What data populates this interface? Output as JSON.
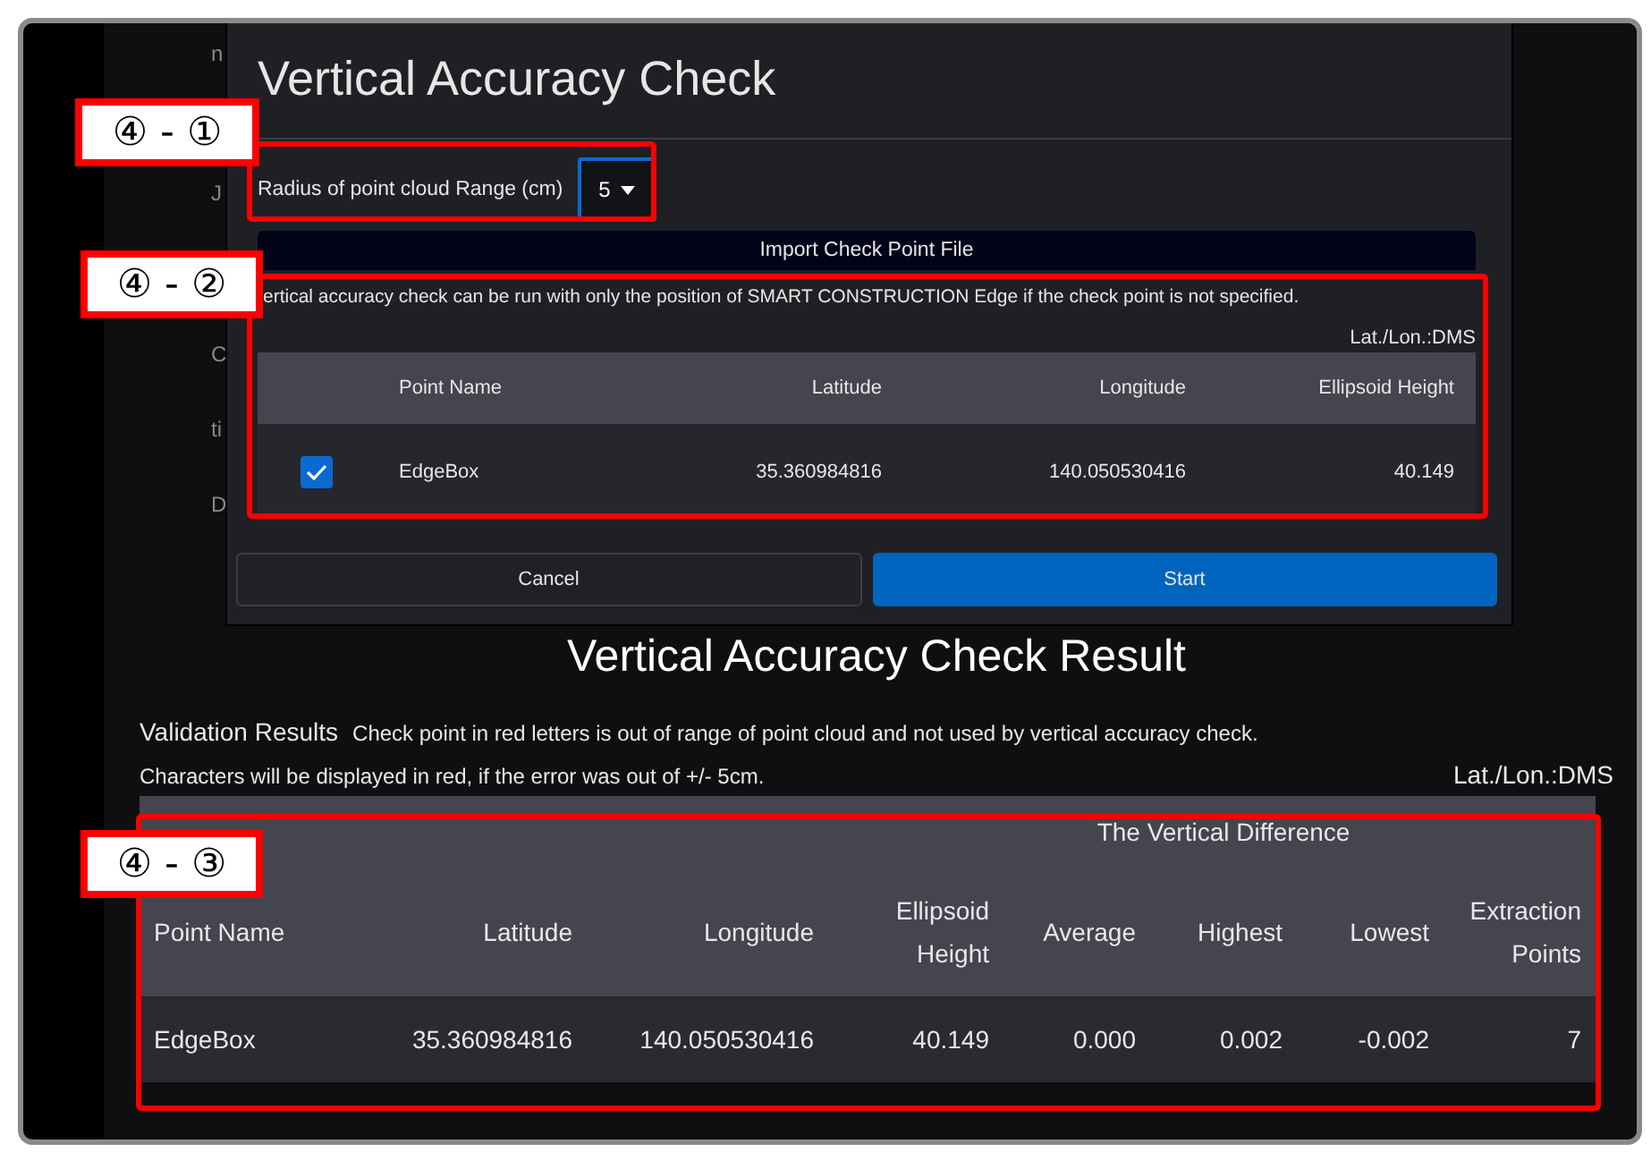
{
  "background_fragments": [
    "n",
    "J",
    "C",
    "ti",
    "D"
  ],
  "dialog": {
    "title": "Vertical Accuracy Check",
    "radius_label": "Radius of point cloud Range (cm)",
    "radius_select": {
      "value": "5"
    },
    "import_button": "Import Check Point File",
    "note": "ertical accuracy check can be run with only the position of SMART CONSTRUCTION Edge if the check point is not specified.",
    "coord_format": "Lat./Lon.:DMS",
    "table": {
      "columns": [
        "Point Name",
        "Latitude",
        "Longitude",
        "Ellipsoid Height"
      ],
      "rows": [
        {
          "checked": true,
          "cells": [
            "EdgeBox",
            "35.360984816",
            "140.050530416",
            "40.149"
          ]
        }
      ]
    },
    "buttons": [
      {
        "label": "Cancel",
        "kind": "secondary"
      },
      {
        "label": "Start",
        "kind": "primary"
      }
    ]
  },
  "result": {
    "title": "Vertical Accuracy Check Result",
    "validation_label": "Validation Results",
    "validation_note": "Check point in red letters is out of range of point cloud and not used by vertical accuracy check.",
    "color_note": "Characters will be displayed in red, if the error was out of +/- 5cm.",
    "coord_format": "Lat./Lon.:DMS",
    "table": {
      "group_header": "The Vertical Difference",
      "columns": [
        "Point Name",
        "Latitude",
        "Longitude",
        "Ellipsoid Height",
        "Average",
        "Highest",
        "Lowest",
        "Extraction Points"
      ],
      "rows": [
        {
          "cells": [
            "EdgeBox",
            "35.360984816",
            "140.050530416",
            "40.149",
            "0.000",
            "0.002",
            "-0.002",
            "7"
          ]
        }
      ]
    }
  },
  "annotations": [
    {
      "label": "④ - ①"
    },
    {
      "label": "④ - ②"
    },
    {
      "label": "④ - ③"
    }
  ]
}
